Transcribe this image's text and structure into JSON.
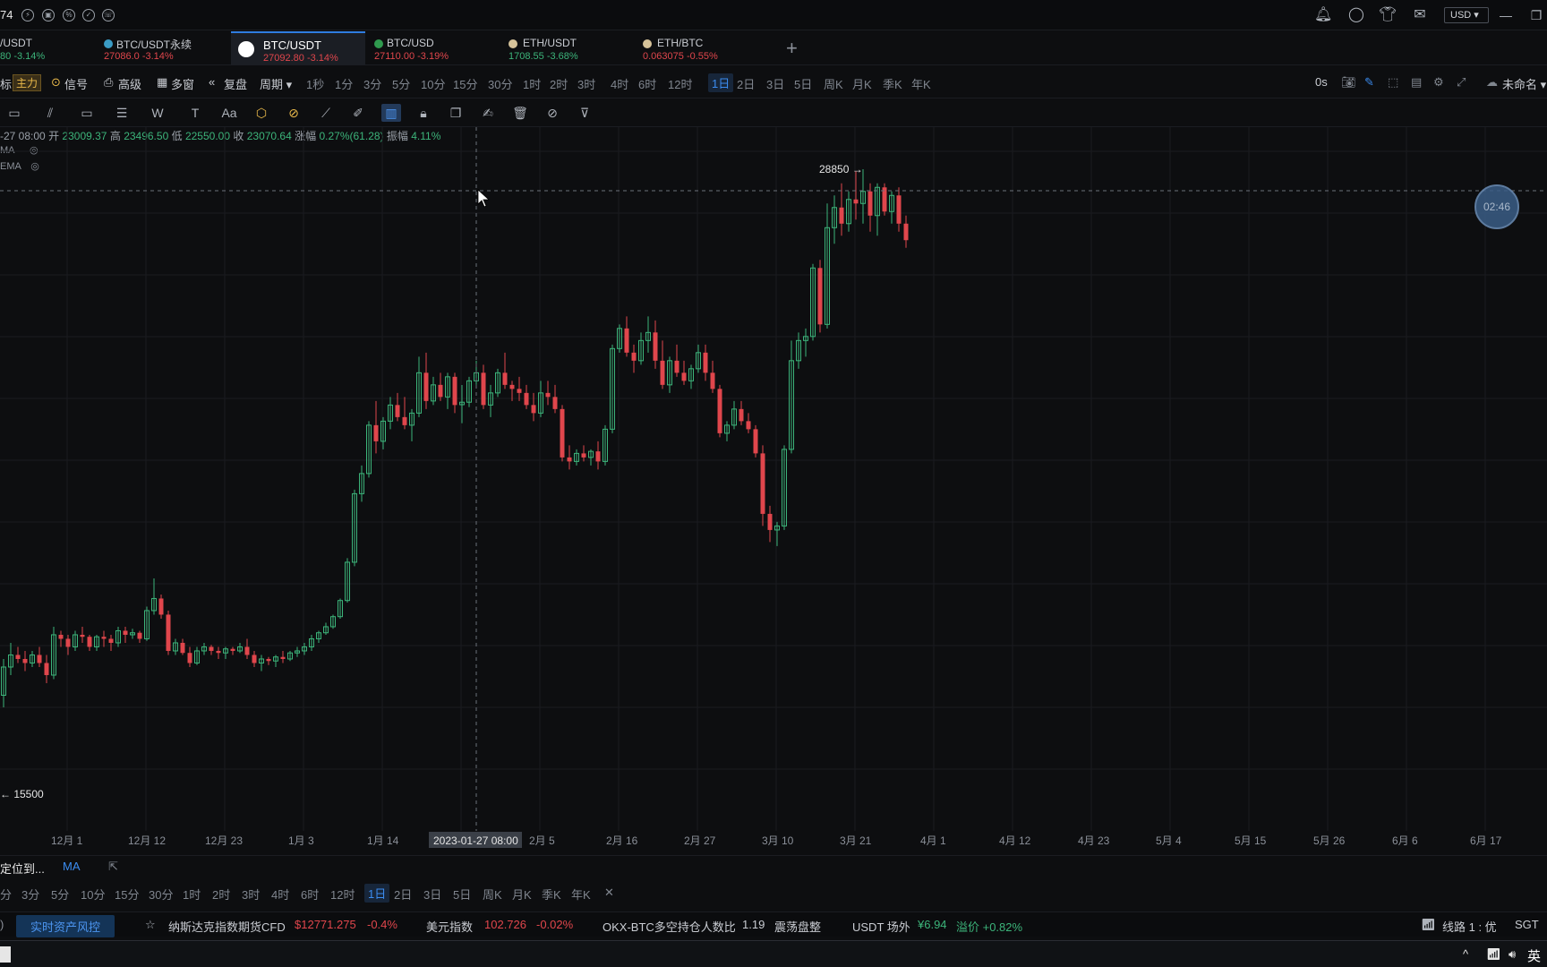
{
  "topbar": {
    "left_number": "74",
    "currency": "USD"
  },
  "tabs": [
    {
      "name": "/USDT",
      "price": "80",
      "change": "-3.14%"
    },
    {
      "name": "BTC/USDT永续",
      "price": "27086.0",
      "change": "-3.14%"
    },
    {
      "name": "BTC/USDT",
      "price": "27092.80",
      "change": "-3.14%",
      "active": true
    },
    {
      "name": "BTC/USD",
      "price": "27110.00",
      "change": "-3.19%"
    },
    {
      "name": "ETH/USDT",
      "price": "1708.55",
      "change": "-3.68%"
    },
    {
      "name": "ETH/BTC",
      "price": "0.063075",
      "change": "-0.55%"
    }
  ],
  "toolbar": {
    "left_labels": [
      "标",
      "主力"
    ],
    "signal": "信号",
    "advanced": "高级",
    "multi_window": "多窗",
    "replay": "复盘",
    "period": "周期",
    "periods": [
      "1秒",
      "1分",
      "3分",
      "5分",
      "10分",
      "15分",
      "30分",
      "1时",
      "2时",
      "3时",
      "4时",
      "6时",
      "12时",
      "1日",
      "2日",
      "3日",
      "5日",
      "周K",
      "月K",
      "季K",
      "年K"
    ],
    "active_period": "1日",
    "countdown": "0s",
    "unnamed": "未命名"
  },
  "ohlc": {
    "date": "-27 08:00",
    "open_label": "开",
    "open": "23009.37",
    "high_label": "高",
    "high": "23496.50",
    "low_label": "低",
    "low": "22550.00",
    "close_label": "收",
    "close": "23070.64",
    "change_label": "涨幅",
    "change": "0.27%(61.28)",
    "amp_label": "振幅",
    "amp": "4.11%"
  },
  "indicators": [
    "MA",
    "EMA"
  ],
  "chart_data": {
    "type": "candlestick",
    "high_marker": "28850",
    "low_marker": "15500",
    "crosshair_date": "2023-01-27 08:00",
    "countdown_badge": "02:46",
    "x_ticks": [
      "12月 1",
      "12月 12",
      "12月 23",
      "1月 3",
      "1月 14",
      "2月 5",
      "2月 16",
      "2月 27",
      "3月 10",
      "3月 21",
      "4月 1",
      "4月 12",
      "4月 23",
      "5月 4",
      "5月 15",
      "5月 26",
      "6月 6",
      "6月 17"
    ],
    "candles": [
      [
        15800,
        16700,
        15500,
        16500
      ],
      [
        16500,
        17100,
        16300,
        16800
      ],
      [
        16800,
        17000,
        16600,
        16700
      ],
      [
        16700,
        16900,
        16400,
        16600
      ],
      [
        16600,
        16900,
        16500,
        16800
      ],
      [
        16800,
        17000,
        16500,
        16600
      ],
      [
        16600,
        16800,
        16100,
        16300
      ],
      [
        16300,
        17500,
        16200,
        17300
      ],
      [
        17300,
        17400,
        17000,
        17200
      ],
      [
        17200,
        17300,
        16800,
        17000
      ],
      [
        17000,
        17400,
        16900,
        17300
      ],
      [
        17300,
        17500,
        17100,
        17250
      ],
      [
        17250,
        17300,
        16900,
        17000
      ],
      [
        17000,
        17300,
        16900,
        17250
      ],
      [
        17250,
        17400,
        17000,
        17200
      ],
      [
        17200,
        17300,
        16900,
        17100
      ],
      [
        17100,
        17500,
        17000,
        17400
      ],
      [
        17400,
        17500,
        17100,
        17300
      ],
      [
        17300,
        17450,
        17200,
        17350
      ],
      [
        17350,
        17400,
        17100,
        17200
      ],
      [
        17200,
        18000,
        17150,
        17900
      ],
      [
        17900,
        18700,
        17800,
        18200
      ],
      [
        18200,
        18300,
        17700,
        17800
      ],
      [
        17800,
        17900,
        16800,
        16900
      ],
      [
        16900,
        17200,
        16800,
        17100
      ],
      [
        17100,
        17200,
        16800,
        16850
      ],
      [
        16850,
        17000,
        16500,
        16600
      ],
      [
        16600,
        17000,
        16550,
        16900
      ],
      [
        16900,
        17100,
        16800,
        17000
      ],
      [
        17000,
        17050,
        16800,
        16900
      ],
      [
        16900,
        17000,
        16700,
        16850
      ],
      [
        16850,
        17000,
        16700,
        16950
      ],
      [
        16950,
        17000,
        16800,
        16900
      ],
      [
        16900,
        17100,
        16850,
        17000
      ],
      [
        17000,
        17200,
        16700,
        16800
      ],
      [
        16800,
        16900,
        16500,
        16600
      ],
      [
        16600,
        16800,
        16400,
        16700
      ],
      [
        16700,
        16750,
        16550,
        16650
      ],
      [
        16650,
        16800,
        16500,
        16750
      ],
      [
        16750,
        16900,
        16600,
        16700
      ],
      [
        16700,
        16900,
        16650,
        16850
      ],
      [
        16850,
        17000,
        16750,
        16900
      ],
      [
        16900,
        17100,
        16800,
        17000
      ],
      [
        17000,
        17300,
        16900,
        17200
      ],
      [
        17200,
        17400,
        17100,
        17350
      ],
      [
        17350,
        17600,
        17300,
        17500
      ],
      [
        17500,
        17800,
        17450,
        17750
      ],
      [
        17750,
        18200,
        17700,
        18150
      ],
      [
        18150,
        19200,
        18100,
        19100
      ],
      [
        19100,
        20900,
        19000,
        20800
      ],
      [
        20800,
        21500,
        20600,
        21300
      ],
      [
        21300,
        22600,
        21200,
        22500
      ],
      [
        22500,
        23100,
        21800,
        22100
      ],
      [
        22100,
        22700,
        21900,
        22600
      ],
      [
        22600,
        23200,
        22400,
        23000
      ],
      [
        23000,
        23300,
        22600,
        22700
      ],
      [
        22700,
        23200,
        22400,
        22500
      ],
      [
        22500,
        22900,
        22100,
        22800
      ],
      [
        22800,
        24200,
        22700,
        23800
      ],
      [
        23800,
        24300,
        22900,
        23100
      ],
      [
        23100,
        23700,
        23000,
        23500
      ],
      [
        23500,
        23800,
        23100,
        23200
      ],
      [
        23200,
        23800,
        22900,
        23700
      ],
      [
        23700,
        23800,
        22800,
        23000
      ],
      [
        23009,
        23496,
        22550,
        23070
      ],
      [
        23070,
        23700,
        22950,
        23600
      ],
      [
        23600,
        24100,
        23500,
        23800
      ],
      [
        23800,
        24000,
        22900,
        23000
      ],
      [
        23000,
        23500,
        22700,
        23300
      ],
      [
        23300,
        23900,
        23200,
        23800
      ],
      [
        23800,
        24300,
        23400,
        23500
      ],
      [
        23500,
        23600,
        23100,
        23400
      ],
      [
        23400,
        23700,
        23100,
        23300
      ],
      [
        23300,
        23500,
        22900,
        23000
      ],
      [
        23000,
        23300,
        22600,
        22800
      ],
      [
        22800,
        23600,
        22700,
        23300
      ],
      [
        23300,
        23600,
        23000,
        23200
      ],
      [
        23200,
        23500,
        22800,
        22900
      ],
      [
        22900,
        23000,
        21600,
        21700
      ],
      [
        21700,
        22000,
        21400,
        21600
      ],
      [
        21600,
        21900,
        21500,
        21800
      ],
      [
        21800,
        22000,
        21600,
        21700
      ],
      [
        21700,
        21900,
        21500,
        21850
      ],
      [
        21850,
        22100,
        21400,
        21600
      ],
      [
        21600,
        22500,
        21500,
        22400
      ],
      [
        22400,
        24500,
        22300,
        24400
      ],
      [
        24400,
        25000,
        24300,
        24900
      ],
      [
        24900,
        25200,
        24200,
        24300
      ],
      [
        24300,
        24500,
        23800,
        24100
      ],
      [
        24100,
        24800,
        24000,
        24600
      ],
      [
        24600,
        25200,
        24300,
        24800
      ],
      [
        24800,
        25100,
        23900,
        24100
      ],
      [
        24100,
        24600,
        23400,
        23500
      ],
      [
        23500,
        24200,
        23300,
        24100
      ],
      [
        24100,
        24500,
        23700,
        23800
      ],
      [
        23800,
        24100,
        23500,
        23600
      ],
      [
        23600,
        24000,
        23400,
        23900
      ],
      [
        23900,
        24500,
        23800,
        24300
      ],
      [
        24300,
        24500,
        23600,
        23800
      ],
      [
        23800,
        24100,
        23300,
        23400
      ],
      [
        23400,
        23500,
        22200,
        22300
      ],
      [
        22300,
        22600,
        22100,
        22500
      ],
      [
        22500,
        23100,
        22400,
        22900
      ],
      [
        22900,
        23100,
        22500,
        22600
      ],
      [
        22600,
        22800,
        22300,
        22400
      ],
      [
        22400,
        22500,
        21700,
        21800
      ],
      [
        21800,
        22000,
        20000,
        20300
      ],
      [
        20300,
        20500,
        19600,
        19900
      ],
      [
        19900,
        20100,
        19500,
        20000
      ],
      [
        20000,
        22000,
        19900,
        21900
      ],
      [
        21900,
        24600,
        21800,
        24100
      ],
      [
        24100,
        24800,
        23900,
        24600
      ],
      [
        24600,
        24900,
        24200,
        24700
      ],
      [
        24700,
        26500,
        24600,
        26400
      ],
      [
        26400,
        26600,
        24800,
        25000
      ],
      [
        25000,
        28000,
        24900,
        27400
      ],
      [
        27400,
        28200,
        27000,
        27900
      ],
      [
        27900,
        28500,
        27200,
        27500
      ],
      [
        27500,
        28300,
        27300,
        28100
      ],
      [
        28100,
        28800,
        27600,
        28000
      ],
      [
        28000,
        28850,
        27500,
        28300
      ],
      [
        28300,
        28500,
        27300,
        27700
      ],
      [
        27700,
        28500,
        27200,
        28400
      ],
      [
        28400,
        28500,
        27700,
        27800
      ],
      [
        27800,
        28300,
        27500,
        28200
      ],
      [
        28200,
        28400,
        27300,
        27500
      ],
      [
        27500,
        27700,
        26900,
        27090
      ]
    ]
  },
  "subpanel": {
    "locate": "定位到...",
    "indicator": "MA",
    "periods": [
      "3分",
      "5分",
      "10分",
      "15分",
      "30分",
      "1时",
      "2时",
      "3时",
      "4时",
      "6时",
      "12时",
      "1日",
      "2日",
      "3日",
      "5日",
      "周K",
      "月K",
      "季K",
      "年K"
    ],
    "active": "1日",
    "left_partial": "分"
  },
  "ticker": {
    "risk_button": "实时资产风控",
    "items": [
      {
        "label": "纳斯达克指数期货CFD",
        "value": "$12771.275",
        "change": "-0.4%"
      },
      {
        "label": "美元指数",
        "value": "102.726",
        "change": "-0.02%"
      },
      {
        "label": "OKX-BTC多空持仓人数比",
        "value": "1.19",
        "change": "震荡盘整"
      },
      {
        "label": "USDT 场外",
        "value": "¥6.94",
        "change": "溢价 +0.82%"
      }
    ],
    "line": "线路 1 : 优",
    "tz": "SGT"
  },
  "taskbar": {
    "ime": "英"
  },
  "colors": {
    "up": "#3cb47a",
    "down": "#e0464c",
    "accent": "#2f7de0",
    "background": "#0d0e10"
  }
}
